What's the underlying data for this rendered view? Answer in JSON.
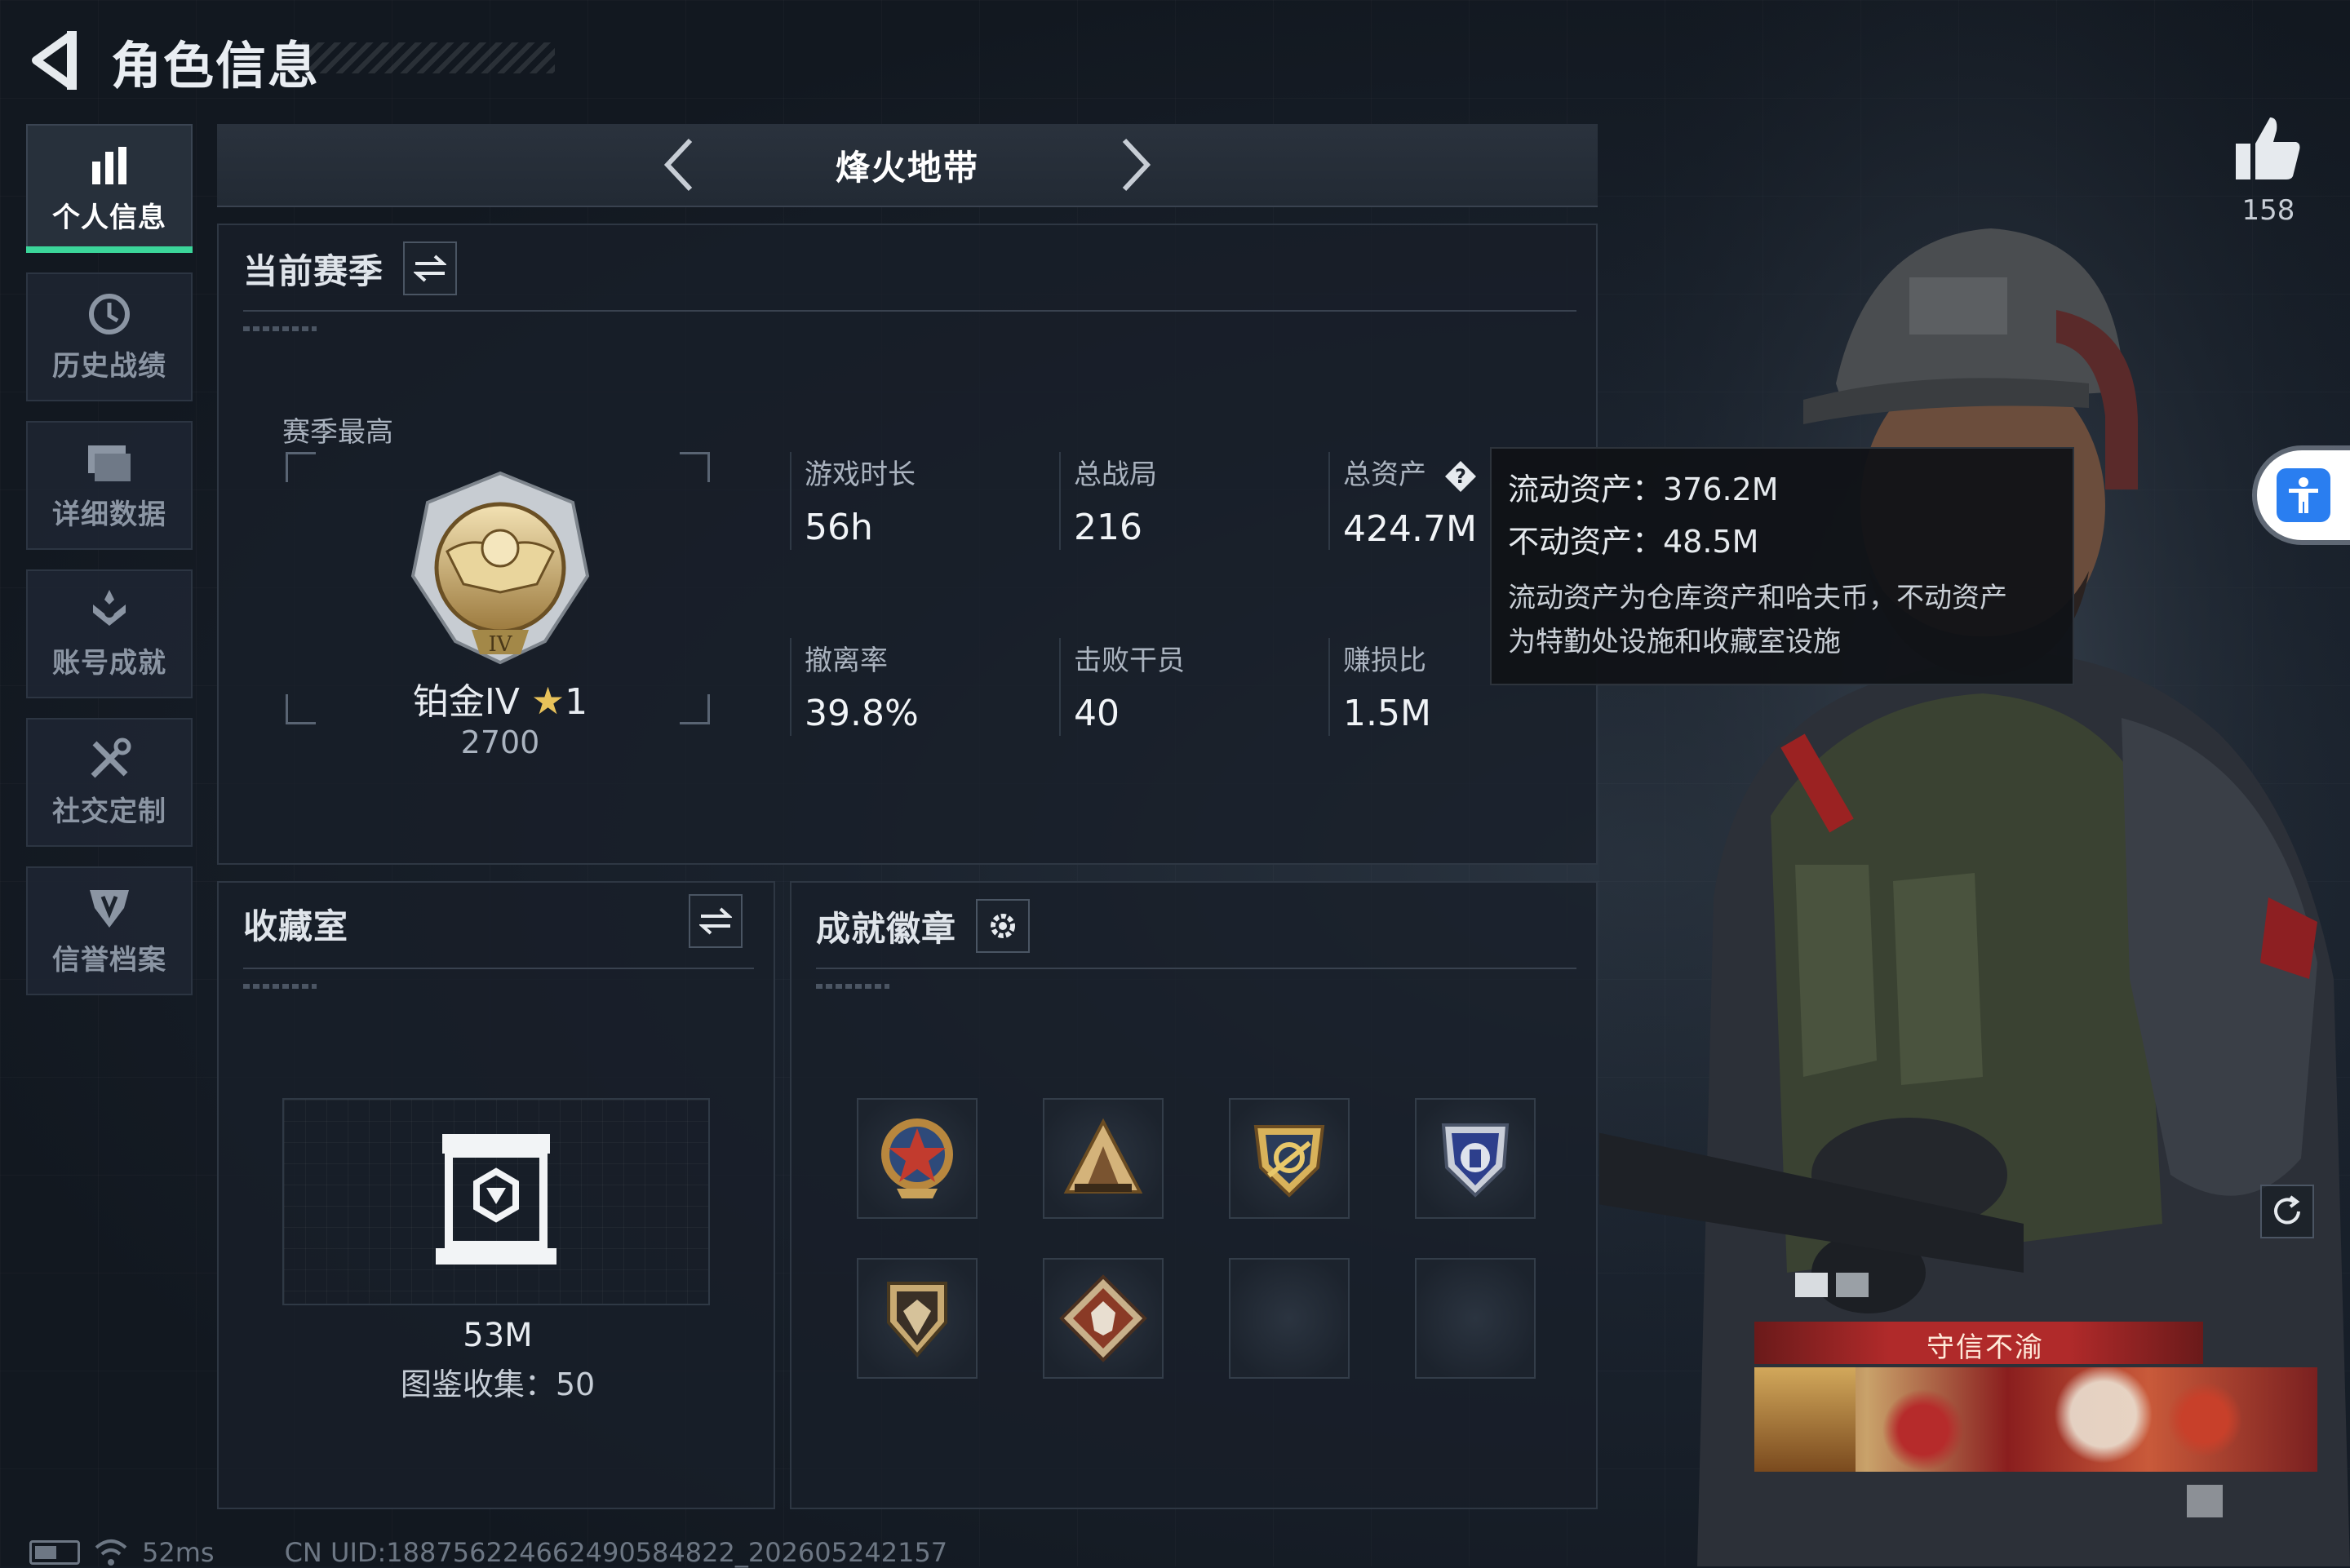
{
  "header": {
    "title": "角色信息"
  },
  "sidebar": {
    "items": [
      {
        "label": "个人信息",
        "icon": "bar-chart-icon",
        "active": true
      },
      {
        "label": "历史战绩",
        "icon": "history-clock-icon",
        "active": false
      },
      {
        "label": "详细数据",
        "icon": "folder-icon",
        "active": false
      },
      {
        "label": "账号成就",
        "icon": "achievement-icon",
        "active": false
      },
      {
        "label": "社交定制",
        "icon": "tools-icon",
        "active": false
      },
      {
        "label": "信誉档案",
        "icon": "credit-shield-icon",
        "active": false
      }
    ]
  },
  "mode": {
    "name": "烽火地带"
  },
  "season": {
    "title": "当前赛季",
    "best_label": "赛季最高",
    "rank_name": "铂金IV",
    "rank_stars": "1",
    "rank_score": "2700",
    "stats": [
      {
        "label": "游戏时长",
        "value": "56h"
      },
      {
        "label": "总战局",
        "value": "216"
      },
      {
        "label": "总资产",
        "value": "424.7M"
      },
      {
        "label": "撤离率",
        "value": "39.8%"
      },
      {
        "label": "击败干员",
        "value": "40"
      },
      {
        "label": "赚损比",
        "value": "1.5M"
      }
    ]
  },
  "tooltip": {
    "liquid": "流动资产：376.2M",
    "fixed": "不动资产：48.5M",
    "note_line1": "流动资产为仓库资产和哈夫币，不动资产",
    "note_line2": "为特勤处设施和收藏室设施"
  },
  "collection": {
    "title": "收藏室",
    "value": "53M",
    "count_text": "图鉴收集：50"
  },
  "badges": {
    "title": "成就徽章",
    "items": [
      {
        "icon": "star-medal-badge-icon",
        "filled": true
      },
      {
        "icon": "pyramid-badge-icon",
        "filled": true
      },
      {
        "icon": "gold-shield-badge-icon",
        "filled": true
      },
      {
        "icon": "blue-shield-badge-icon",
        "filled": true
      },
      {
        "icon": "gem-shield-badge-icon",
        "filled": true
      },
      {
        "icon": "diamond-wolf-badge-icon",
        "filled": true
      },
      {
        "icon": "empty-slot",
        "filled": false
      },
      {
        "icon": "empty-slot",
        "filled": false
      }
    ]
  },
  "likes": {
    "count": "158"
  },
  "player_title": {
    "text": "守信不渝"
  },
  "footer": {
    "ping": "52ms",
    "uid": "CN UID:1887562246624905848​22_202605242157"
  },
  "colors": {
    "accent": "#3bd59a",
    "rank_star": "#e8c25a",
    "title_red": "#b02a2a",
    "access_blue": "#2a7ef0"
  }
}
